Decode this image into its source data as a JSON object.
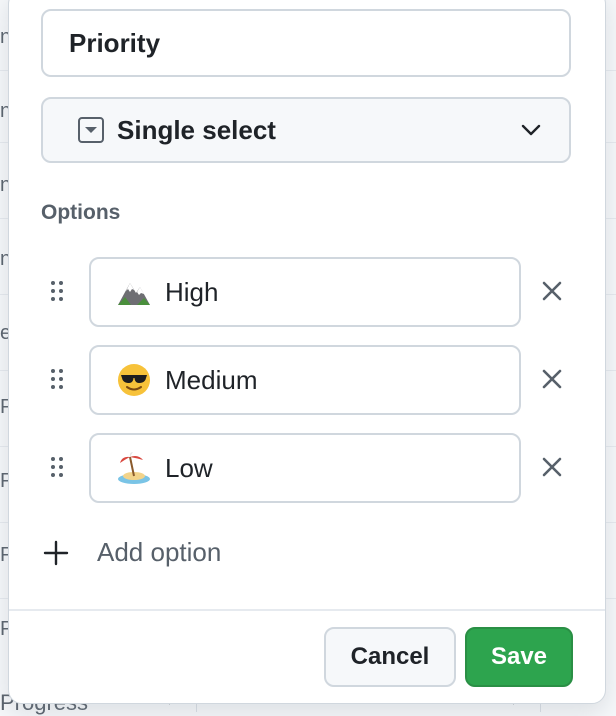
{
  "field": {
    "name_value": "Priority",
    "type_label": "Single select",
    "type_icon": "single-select-icon"
  },
  "options_section": {
    "label": "Options",
    "items": [
      {
        "label": "High",
        "emoji": "⛰️",
        "emoji_name": "mountain-emoji"
      },
      {
        "label": "Medium",
        "emoji": "😎",
        "emoji_name": "sunglasses-face-emoji"
      },
      {
        "label": "Low",
        "emoji": "🏝️",
        "emoji_name": "beach-island-emoji"
      }
    ],
    "add_label": "Add option"
  },
  "footer": {
    "cancel_label": "Cancel",
    "save_label": "Save"
  },
  "background": {
    "fragments": [
      "n",
      "n",
      "n",
      "n",
      "e",
      "Pr",
      "Pr",
      "Pr",
      "Pr"
    ],
    "bottom_text": "Progress"
  },
  "colors": {
    "save_green": "#2da44e",
    "border": "#d0d7de",
    "muted_text": "#57606a"
  }
}
